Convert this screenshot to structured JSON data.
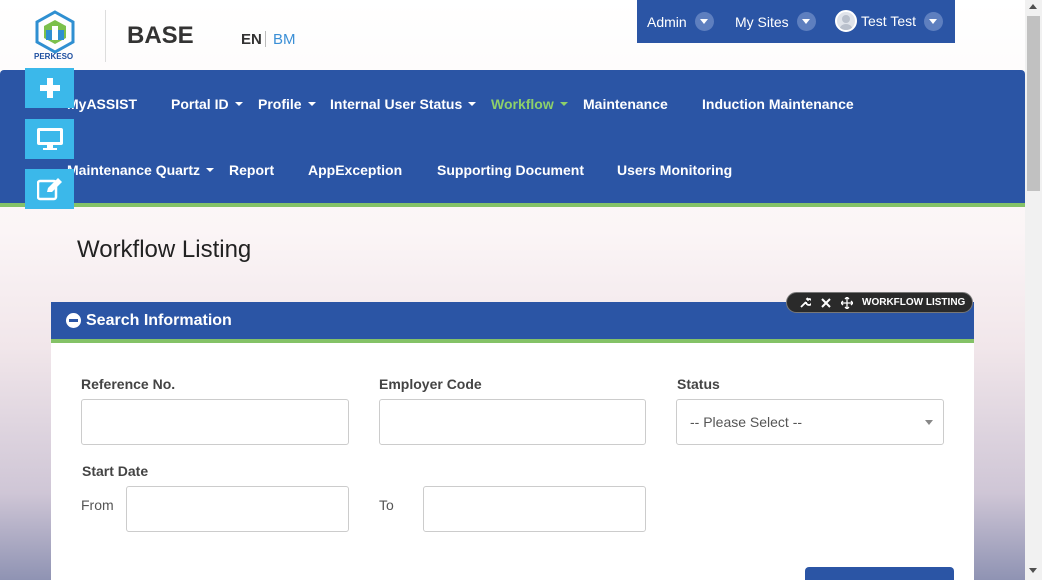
{
  "header": {
    "logo_text": "PERKESO",
    "brand": "BASE",
    "lang_en": "EN",
    "lang_bm": "BM",
    "top_menu": [
      {
        "label": "Admin"
      },
      {
        "label": "My Sites"
      },
      {
        "label": "Test Test"
      }
    ]
  },
  "nav": {
    "row1": [
      "MyASSIST",
      "Portal ID",
      "Profile",
      "Internal User Status",
      "Workflow",
      "Maintenance",
      "Induction Maintenance"
    ],
    "row2": [
      "Maintenance Quartz",
      "Report",
      "AppException",
      "Supporting Document",
      "Users Monitoring"
    ],
    "active": "Workflow",
    "colors": {
      "bar": "#2b55a5",
      "active": "#8dd06a",
      "accent_line": "#84c267"
    }
  },
  "side_buttons": [
    "plus-icon",
    "monitor-icon",
    "edit-icon"
  ],
  "page": {
    "title": "Workflow Listing"
  },
  "widget_bar": {
    "title": "WORKFLOW LISTING",
    "icons": [
      "wrench-icon",
      "close-icon",
      "move-icon"
    ]
  },
  "search_panel": {
    "title": "Search Information",
    "reference_label": "Reference No.",
    "reference_value": "",
    "employer_label": "Employer Code",
    "employer_value": "",
    "status_label": "Status",
    "status_selected": "-- Please Select --",
    "start_date_label": "Start Date",
    "from_label": "From",
    "from_value": "",
    "to_label": "To",
    "to_value": ""
  }
}
